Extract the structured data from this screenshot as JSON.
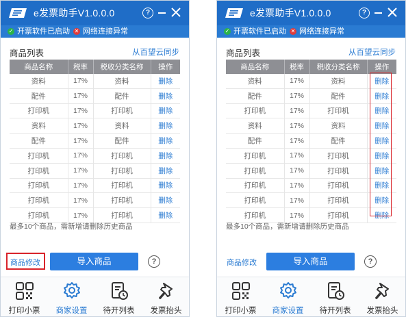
{
  "window": {
    "title": "e发票助手V1.0.0.0",
    "controls": {
      "help": "?"
    }
  },
  "status": [
    {
      "label": "开票软件已启动",
      "state": "ok"
    },
    {
      "label": "网络连接异常",
      "state": "error"
    }
  ],
  "goods_list": {
    "section_title": "商品列表",
    "sync_link": "从百望云同步",
    "columns": [
      "商品名称",
      "税率",
      "税收分类名称",
      "操作"
    ],
    "rows": [
      {
        "name": "资料",
        "rate": "17%",
        "category": "资料",
        "action": "删除"
      },
      {
        "name": "配件",
        "rate": "17%",
        "category": "配件",
        "action": "删除"
      },
      {
        "name": "打印机",
        "rate": "17%",
        "category": "打印机",
        "action": "删除"
      },
      {
        "name": "资料",
        "rate": "17%",
        "category": "资料",
        "action": "删除"
      },
      {
        "name": "配件",
        "rate": "17%",
        "category": "配件",
        "action": "删除"
      },
      {
        "name": "打印机",
        "rate": "17%",
        "category": "打印机",
        "action": "删除"
      },
      {
        "name": "打印机",
        "rate": "17%",
        "category": "打印机",
        "action": "删除"
      },
      {
        "name": "打印机",
        "rate": "17%",
        "category": "打印机",
        "action": "删除"
      },
      {
        "name": "打印机",
        "rate": "17%",
        "category": "打印机",
        "action": "删除"
      },
      {
        "name": "打印机",
        "rate": "17%",
        "category": "打印机",
        "action": "删除"
      }
    ],
    "hint": "最多10个商品，需新增请删除历史商品"
  },
  "actions": {
    "edit_link": "商品修改",
    "import_button": "导入商品",
    "help": "?"
  },
  "tabs": [
    {
      "label": "打印小票",
      "icon": "qr-grid-icon",
      "active": false
    },
    {
      "label": "商家设置",
      "icon": "gear-icon",
      "active": true
    },
    {
      "label": "待开列表",
      "icon": "pending-list-icon",
      "active": false
    },
    {
      "label": "发票抬头",
      "icon": "pin-icon",
      "active": false
    }
  ],
  "colors": {
    "titlebar": "#1f6dc7",
    "statusbar": "#2a7bd2",
    "accent": "#2a7bd2",
    "highlight_red": "#d9232a",
    "table_header": "#8e8f94",
    "ok_green": "#2cb34a",
    "error_red": "#e03b3b"
  },
  "annotations": {
    "left_panel_highlight": "edit-link",
    "right_panel_highlight": "delete-column"
  }
}
